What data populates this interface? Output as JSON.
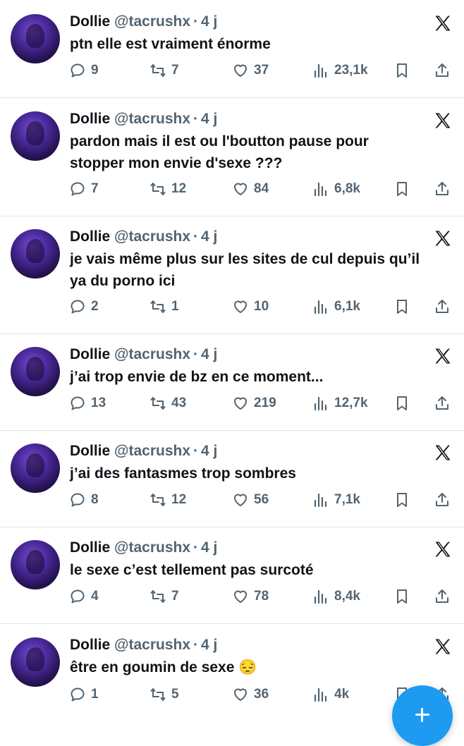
{
  "tweets": [
    {
      "name": "Dollie",
      "handle": "@tacrushx",
      "time": "4 j",
      "text": "ptn elle est vraiment énorme",
      "replies": "9",
      "retweets": "7",
      "likes": "37",
      "views": "23,1k"
    },
    {
      "name": "Dollie",
      "handle": "@tacrushx",
      "time": "4 j",
      "text": "pardon mais il est ou l'boutton pause pour stopper mon envie d'sexe ???",
      "replies": "7",
      "retweets": "12",
      "likes": "84",
      "views": "6,8k"
    },
    {
      "name": "Dollie",
      "handle": "@tacrushx",
      "time": "4 j",
      "text": "je vais même plus sur les sites de cul depuis qu’il ya du porno ici",
      "replies": "2",
      "retweets": "1",
      "likes": "10",
      "views": "6,1k"
    },
    {
      "name": "Dollie",
      "handle": "@tacrushx",
      "time": "4 j",
      "text": "j’ai trop envie de bz en ce moment...",
      "replies": "13",
      "retweets": "43",
      "likes": "219",
      "views": "12,7k"
    },
    {
      "name": "Dollie",
      "handle": "@tacrushx",
      "time": "4 j",
      "text": "j’ai des fantasmes trop sombres",
      "replies": "8",
      "retweets": "12",
      "likes": "56",
      "views": "7,1k"
    },
    {
      "name": "Dollie",
      "handle": "@tacrushx",
      "time": "4 j",
      "text": "le sexe c’est tellement pas surcoté",
      "replies": "4",
      "retweets": "7",
      "likes": "78",
      "views": "8,4k"
    },
    {
      "name": "Dollie",
      "handle": "@tacrushx",
      "time": "4 j",
      "text": "être en goumin de sexe 😔",
      "replies": "1",
      "retweets": "5",
      "likes": "36",
      "views": "4k"
    }
  ],
  "icons": {
    "reply": "reply-icon",
    "retweet": "retweet-icon",
    "like": "heart-icon",
    "views": "views-icon",
    "bookmark": "bookmark-icon",
    "share": "share-icon",
    "platform": "x-logo-icon",
    "compose": "plus-icon"
  },
  "colors": {
    "text": "#0f1419",
    "muted": "#536471",
    "accent": "#1d9bf0",
    "divider": "#e1e5ea"
  }
}
